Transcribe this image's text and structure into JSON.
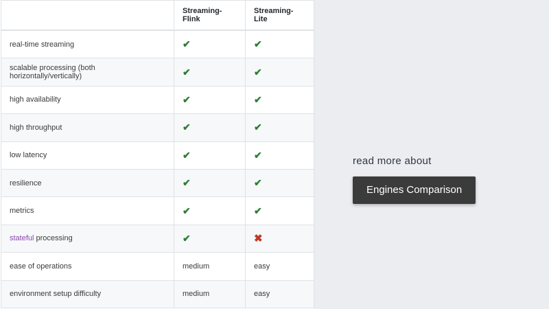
{
  "table": {
    "headers": [
      "",
      "Streaming-Flink",
      "Streaming-Lite"
    ],
    "rows": [
      {
        "feature": "real-time streaming",
        "flink": "✔",
        "lite": "✔"
      },
      {
        "feature": "scalable processing (both horizontally/vertically)",
        "flink": "✔",
        "lite": "✔"
      },
      {
        "feature": "high availability",
        "flink": "✔",
        "lite": "✔"
      },
      {
        "feature": "high throughput",
        "flink": "✔",
        "lite": "✔"
      },
      {
        "feature": "low latency",
        "flink": "✔",
        "lite": "✔"
      },
      {
        "feature": "resilience",
        "flink": "✔",
        "lite": "✔"
      },
      {
        "feature": "metrics",
        "flink": "✔",
        "lite": "✔"
      },
      {
        "feature_link": "stateful",
        "feature_rest": " processing",
        "flink": "✔",
        "lite": "✖"
      },
      {
        "feature": "ease of operations",
        "flink": "medium",
        "lite": "easy"
      },
      {
        "feature": "environment setup difficulty",
        "flink": "medium",
        "lite": "easy"
      }
    ]
  },
  "side": {
    "read_more": "read more about",
    "button_label": "Engines Comparison"
  },
  "colors": {
    "check": "#2e7d32",
    "cross": "#c0392b",
    "link": "#8e44ad",
    "button_bg": "#3b3b3b"
  }
}
